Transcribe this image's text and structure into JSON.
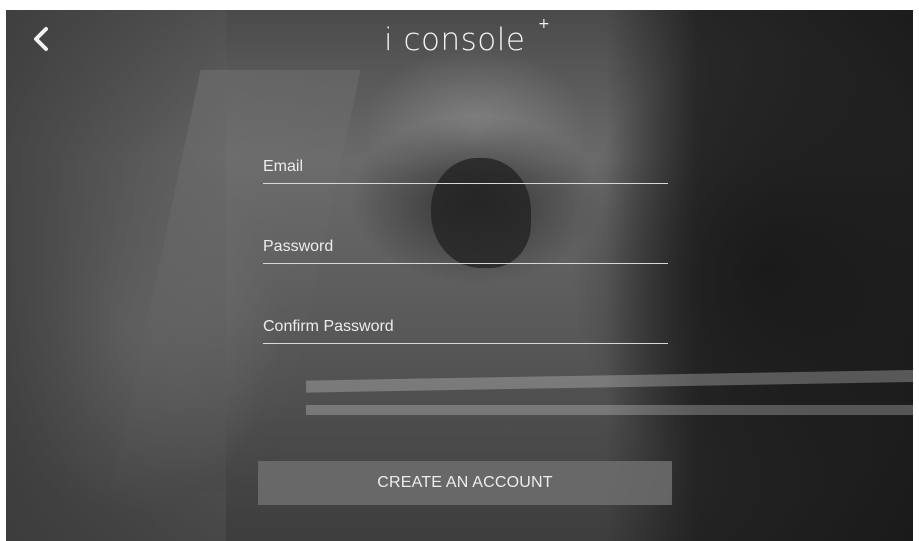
{
  "header": {
    "back_icon": "chevron-left-icon",
    "logo_text": "i console",
    "logo_superscript": "+"
  },
  "form": {
    "email_placeholder": "Email",
    "password_placeholder": "Password",
    "confirm_password_placeholder": "Confirm Password",
    "submit_label": "CREATE AN ACCOUNT"
  },
  "colors": {
    "text": "#ececec",
    "underline": "#d8d8d8",
    "button_bg": "#6e6e6e"
  }
}
